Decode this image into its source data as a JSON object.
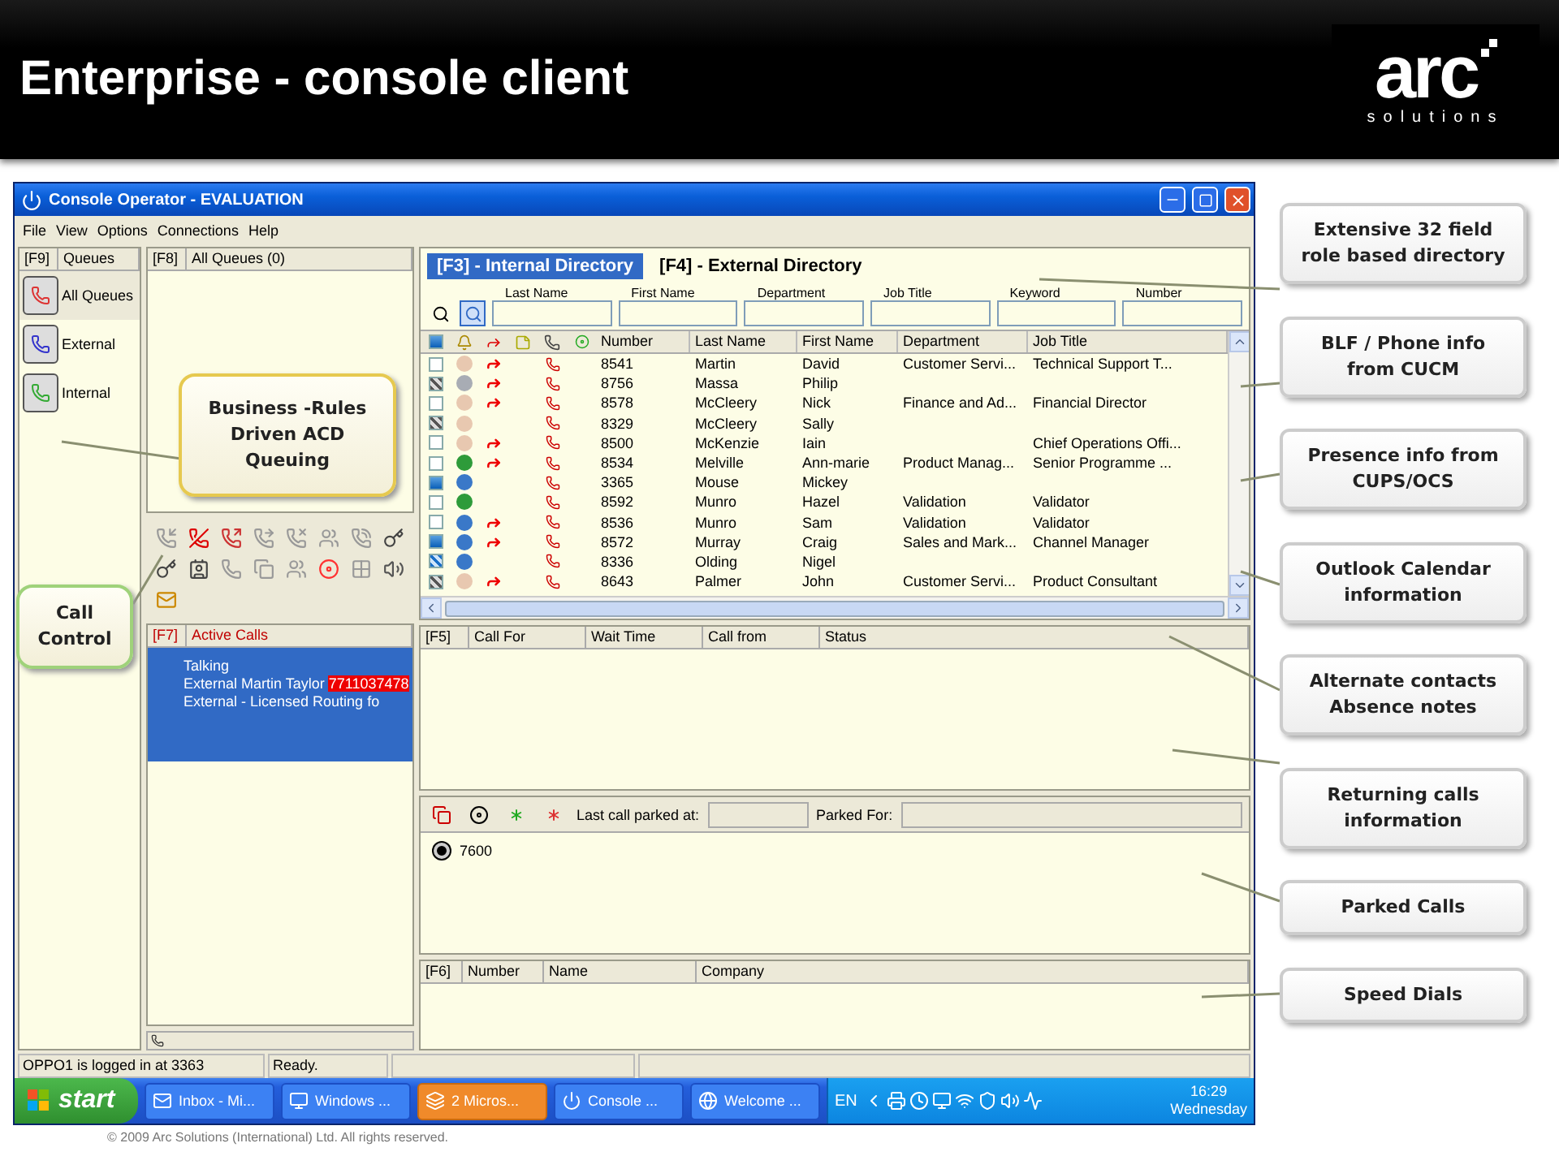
{
  "slide": {
    "title": "Enterprise - console client",
    "logo": {
      "wordmark": "arc",
      "tagline": "solutions"
    }
  },
  "window": {
    "title": "Console Operator - EVALUATION"
  },
  "menu": [
    "File",
    "View",
    "Options",
    "Connections",
    "Help"
  ],
  "queues": {
    "key": "[F9]",
    "label": "Queues",
    "items": [
      {
        "label": "All Queues",
        "selected": true
      },
      {
        "label": "External",
        "selected": false
      },
      {
        "label": "Internal",
        "selected": false
      }
    ]
  },
  "queue_calls": {
    "key": "[F8]",
    "label": "All Queues (0)"
  },
  "active_calls": {
    "key": "[F7]",
    "label": "Active Calls",
    "call": {
      "selected": true,
      "status": "Talking",
      "caller": "External Martin Taylor",
      "number": "7711037478",
      "route": "External - Licensed Routing fo"
    }
  },
  "directory": {
    "tabs": [
      {
        "label": "[F3] - Internal Directory",
        "selected": true
      },
      {
        "label": "[F4] - External Directory",
        "selected": false
      }
    ],
    "search_fields": [
      "Last Name",
      "First Name",
      "Department",
      "Job Title",
      "Keyword",
      "Number"
    ],
    "columns": [
      "Number",
      "Last Name",
      "First Name",
      "Department",
      "Job Title"
    ],
    "rows": [
      {
        "kind": "free",
        "color": "#e8c8b0",
        "forwarded": true,
        "number": "8541",
        "last_name": "Martin",
        "first_name": "David",
        "department": "Customer Servi...",
        "job_title": "Technical Support T..."
      },
      {
        "kind": "busy",
        "color": "#a8acb4",
        "forwarded": true,
        "number": "8756",
        "last_name": "Massa",
        "first_name": "Philip"
      },
      {
        "kind": "free",
        "color": "#e8c8b0",
        "forwarded": true,
        "number": "8578",
        "last_name": "McCleery",
        "first_name": "Nick",
        "department": "Finance and Ad...",
        "job_title": "Financial Director"
      },
      {
        "kind": "busy",
        "color": "#e8c8b0",
        "forwarded": false,
        "number": "8329",
        "last_name": "McCleery",
        "first_name": "Sally"
      },
      {
        "kind": "free",
        "color": "#e8c8b0",
        "forwarded": true,
        "number": "8500",
        "last_name": "McKenzie",
        "first_name": "Iain",
        "job_title": "Chief Operations Offi..."
      },
      {
        "kind": "free",
        "color": "#2e9b3a",
        "forwarded": true,
        "number": "8534",
        "last_name": "Melville",
        "first_name": "Ann-marie",
        "department": "Product Manag...",
        "job_title": "Senior Programme ..."
      },
      {
        "kind": "away",
        "color": "#3a78c8",
        "forwarded": false,
        "number": "3365",
        "last_name": "Mouse",
        "first_name": "Mickey"
      },
      {
        "kind": "free",
        "color": "#2e9b3a",
        "forwarded": false,
        "number": "8592",
        "last_name": "Munro",
        "first_name": "Hazel",
        "department": "Validation",
        "job_title": "Validator"
      },
      {
        "kind": "free",
        "color": "#3a78c8",
        "forwarded": true,
        "number": "8536",
        "last_name": "Munro",
        "first_name": "Sam",
        "department": "Validation",
        "job_title": "Validator"
      },
      {
        "kind": "away",
        "color": "#3a78c8",
        "forwarded": true,
        "number": "8572",
        "last_name": "Murray",
        "first_name": "Craig",
        "department": "Sales and Mark...",
        "job_title": "Channel Manager"
      },
      {
        "kind": "tentative",
        "color": "#3a78c8",
        "forwarded": false,
        "number": "8336",
        "last_name": "Olding",
        "first_name": "Nigel"
      },
      {
        "kind": "busy",
        "color": "#e8c8b0",
        "forwarded": true,
        "number": "8643",
        "last_name": "Palmer",
        "first_name": "John",
        "department": "Customer Servi...",
        "job_title": "Product Consultant"
      }
    ]
  },
  "waiting_calls": {
    "key": "[F5]",
    "columns": [
      "Call For",
      "Wait Time",
      "Call from",
      "Status"
    ]
  },
  "park": {
    "last_parked_label": "Last call parked at:",
    "parked_for_label": "Parked For:",
    "items": [
      "7600"
    ]
  },
  "speed_dials": {
    "key": "[F6]",
    "columns": [
      "Number",
      "Name",
      "Company"
    ]
  },
  "status_bar": [
    "OPPO1 is logged in at 3363",
    "Ready."
  ],
  "taskbar": {
    "start": "start",
    "tasks": [
      {
        "kind": "mail",
        "label": "Inbox - Mi...",
        "selected": false
      },
      {
        "kind": "computer",
        "label": "Windows ...",
        "selected": false
      },
      {
        "kind": "group",
        "label": "2 Micros...",
        "selected": true
      },
      {
        "kind": "console",
        "label": "Console ...",
        "selected": false
      },
      {
        "kind": "browser",
        "label": "Welcome ...",
        "selected": false
      }
    ],
    "language": "EN",
    "time": "16:29",
    "day": "Wednesday"
  },
  "callouts": [
    {
      "text": "Extensive 32 field role based directory"
    },
    {
      "text": "BLF / Phone info from CUCM"
    },
    {
      "text": "Presence info from CUPS/OCS"
    },
    {
      "text": "Outlook Calendar information"
    },
    {
      "text": "Alternate contacts Absence notes"
    },
    {
      "text": "Returning calls information"
    },
    {
      "text": "Parked Calls"
    },
    {
      "text": "Speed Dials"
    }
  ],
  "business_callout": "Business -Rules Driven ACD Queuing",
  "call_control_callout": "Call Control",
  "copyright": "© 2009 Arc Solutions (International) Ltd. All rights reserved."
}
